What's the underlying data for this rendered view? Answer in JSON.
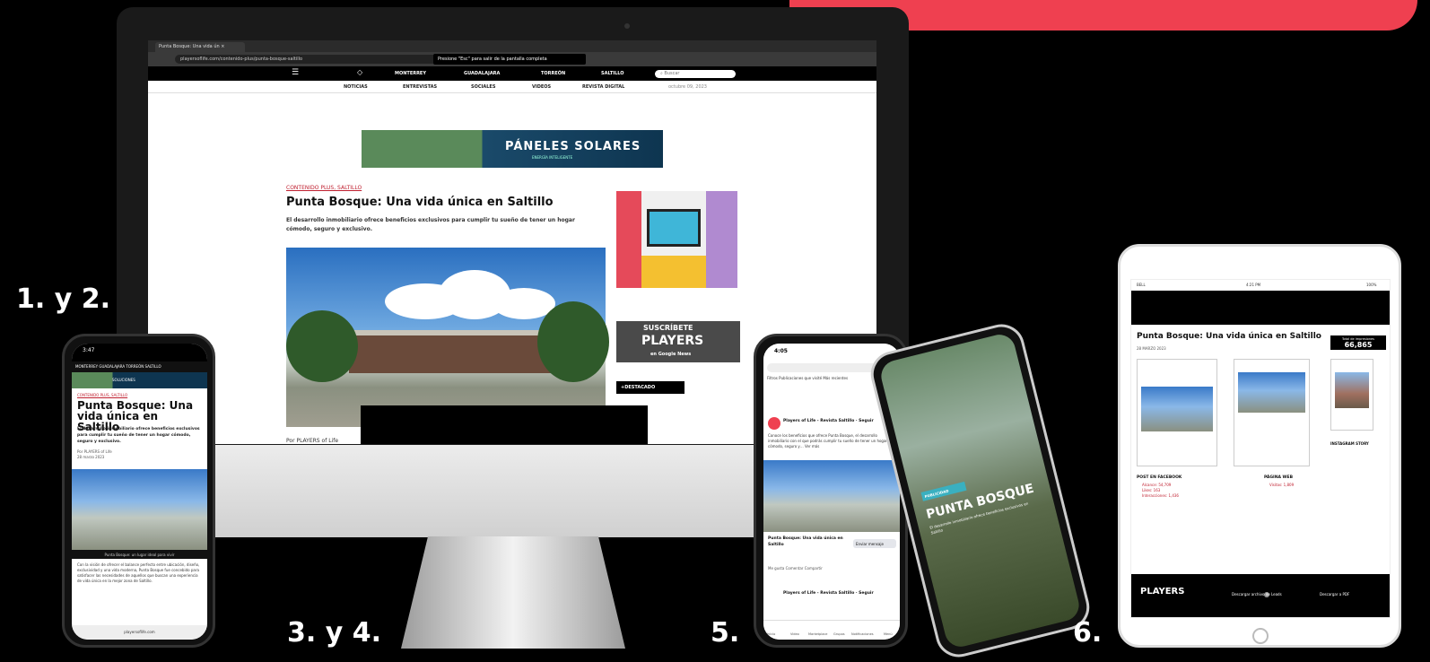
{
  "labels": {
    "step1": "1. y 2.",
    "step2": "3. y 4.",
    "step3": "5.",
    "step4": "6."
  },
  "colors": {
    "brand_red": "#ef4050",
    "background": "#000000"
  },
  "desktop": {
    "tab_title": "Punta Bosque: Una vida ún ×",
    "url": "playersoflife.com/contenido-plus/punta-bosque-saltillo",
    "fullscreen_hint": "Presione \"Esc\" para salir de la pantalla completa",
    "nav": [
      "MONTERREY",
      "GUADALAJARA",
      "TORREÓN",
      "SALTILLO"
    ],
    "search_placeholder": "Buscar",
    "subnav": [
      "NOTICIAS",
      "ENTREVISTAS",
      "SOCIALES",
      "VIDEOS",
      "REVISTA DIGITAL"
    ],
    "date": "octubre 09, 2023",
    "ad_title": "PÁNELES SOLARES",
    "ad_sub": "ENERGÍA INTELIGENTE",
    "kicker": "CONTENIDO PLUS, SALTILLO",
    "headline": "Punta Bosque: Una vida única en Saltillo",
    "dek": "El desarrollo inmobiliario ofrece beneficios exclusivos para cumplir tu sueño de tener un hogar cómodo, seguro y exclusivo.",
    "byline": "Por PLAYERS of Life",
    "side_ad_line1": "SUSCRÍBETE",
    "side_ad_line2": "PLAYERS",
    "side_ad_line3": "en Google News",
    "destacado": "+DESTACADO"
  },
  "phone1": {
    "time": "3:47",
    "nav": "MONTERREY  GUADALAJARA  TORREÓN  SALTILLO",
    "ad": "SOLUCIONES",
    "kicker": "CONTENIDO PLUS, SALTILLO",
    "headline": "Punta Bosque: Una vida única en Saltillo",
    "dek": "El desarrollo inmobiliario ofrece beneficios exclusivos para cumplir tu sueño de tener un hogar cómodo, seguro y exclusivo.",
    "byline": "Por PLAYERS of Life",
    "date": "28 marzo 2023",
    "caption": "Punta Bosque: un lugar ideal para vivir",
    "body": "Con la visión de ofrecer el balance perfecto entre ubicación, diseño, exclusividad y una vida moderna, Punta Bosque fue concebido para satisfacer las necesidades de aquellos que buscan una experiencia de vida única en la mejor zona de Saltillo.",
    "url": "playersoflife.com"
  },
  "phone3": {
    "time": "4:05",
    "chips": "Filtros   Publicaciones que visité   Más recientes",
    "page_name": "Players of Life - Revista Saltillo · Seguir",
    "post_text": "Conoce los beneficios que ofrece Punta Bosque, el desarrollo inmobiliario con el que podrás cumplir tu sueño de tener un hogar cómodo, seguro y… Ver más",
    "link_title": "Punta Bosque: Una vida única en Saltillo",
    "link_button": "Enviar mensaje",
    "reactions": "Me gusta    Comentar    Compartir",
    "page_name2": "Players of Life - Revista Saltillo · Seguir",
    "tabs": [
      "Inicio",
      "Video",
      "Marketplace",
      "Grupos",
      "Notificaciones",
      "Menú"
    ]
  },
  "phone4": {
    "tag": "PUBLICIDAD",
    "title": "PUNTA BOSQUE",
    "sub": "El desarrollo inmobiliario ofrece beneficios exclusivos en Saltillo"
  },
  "tablet": {
    "status": "BELL",
    "time": "4:21 PM",
    "battery": "100%",
    "title": "Punta Bosque: Una vida única en Saltillo",
    "date": "28 MARZO 2023",
    "total_label": "Total de impresiones",
    "total_value": "66,865",
    "ig_label": "INSTAGRAM STORY",
    "fb_title": "POST EN FACEBOOK",
    "fb_list": [
      "Alcance: 54,709",
      "Likes: 163",
      "Interacciones: 1,436"
    ],
    "web_title": "PÁGINA WEB",
    "web_list": "Visitas: 1,809",
    "logo": "PLAYERS",
    "download1": "Descargar archivo de Leads",
    "download2": "Descargar a PDF"
  }
}
